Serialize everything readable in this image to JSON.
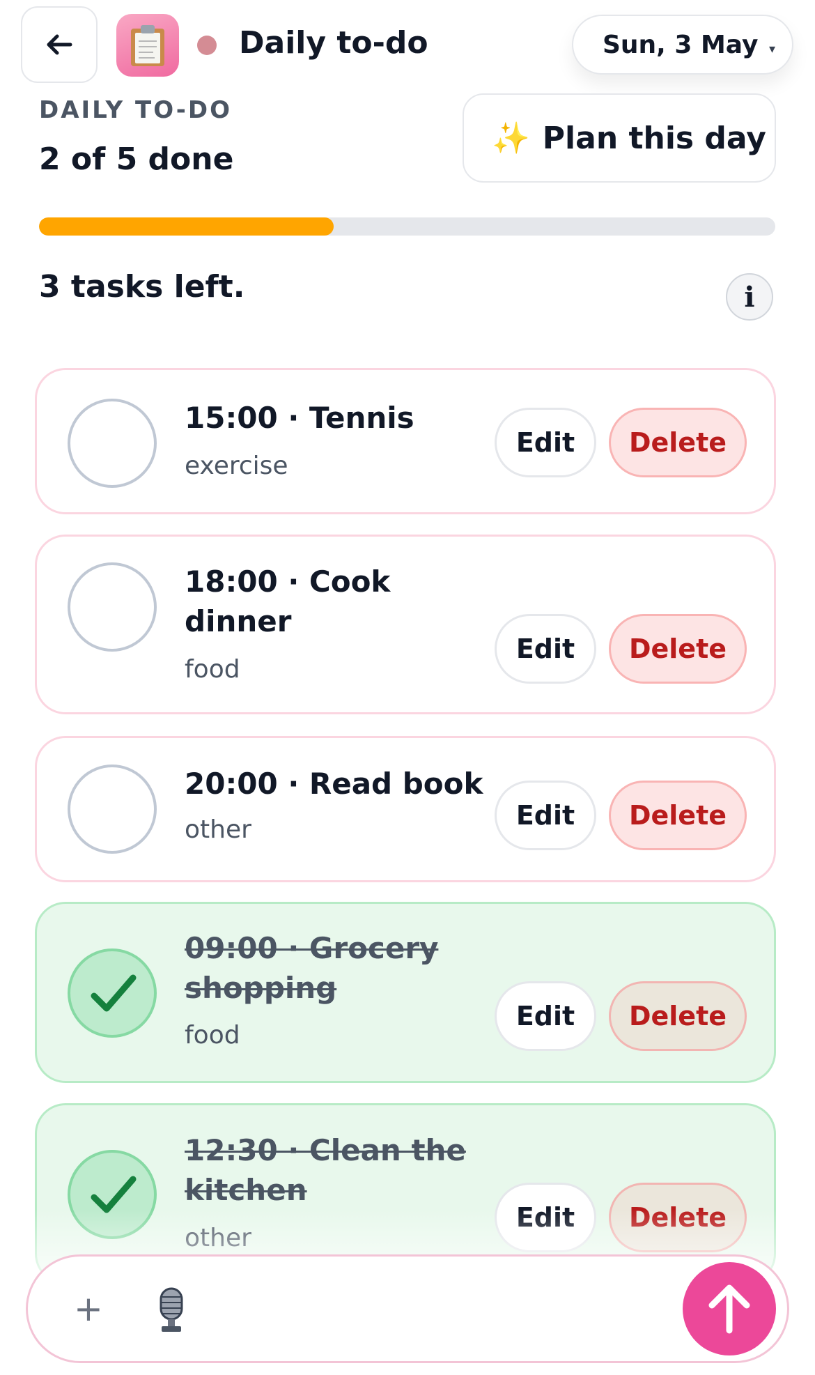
{
  "header": {
    "back_icon": "arrow-left-icon",
    "app_icon": "clipboard-icon",
    "status_dot_color": "#d48c94",
    "title": "Daily to-do",
    "date": "Sun, 3 May",
    "date_chevron": "▾"
  },
  "summary": {
    "section_label": "DAILY TO-DO",
    "done_text": "2 of 5 done",
    "plan_icon": "✨",
    "plan_label": "Plan this day",
    "progress_fraction": 0.4,
    "progress_color": "#ffa500",
    "tasks_left": "3 tasks left.",
    "info_label": "i"
  },
  "tasks": [
    {
      "title": "15:00 · Tennis",
      "category": "exercise",
      "done": false,
      "edit_label": "Edit",
      "delete_label": "Delete"
    },
    {
      "title": "18:00 · Cook dinner",
      "category": "food",
      "done": false,
      "edit_label": "Edit",
      "delete_label": "Delete"
    },
    {
      "title": "20:00 · Read book",
      "category": "other",
      "done": false,
      "edit_label": "Edit",
      "delete_label": "Delete"
    },
    {
      "title": "09:00 · Grocery shopping",
      "category": "food",
      "done": true,
      "edit_label": "Edit",
      "delete_label": "Delete"
    },
    {
      "title": "12:30 · Clean the kitchen",
      "category": "other",
      "done": true,
      "edit_label": "Edit",
      "delete_label": "Delete"
    }
  ],
  "composer": {
    "plus_label": "+",
    "mic_icon": "microphone-icon",
    "send_icon": "arrow-up-icon",
    "send_color": "#ec4899"
  },
  "colors": {
    "check_green": "#15803d",
    "delete_red": "#b91c1c",
    "card_border_pink": "#fbd5e0"
  }
}
